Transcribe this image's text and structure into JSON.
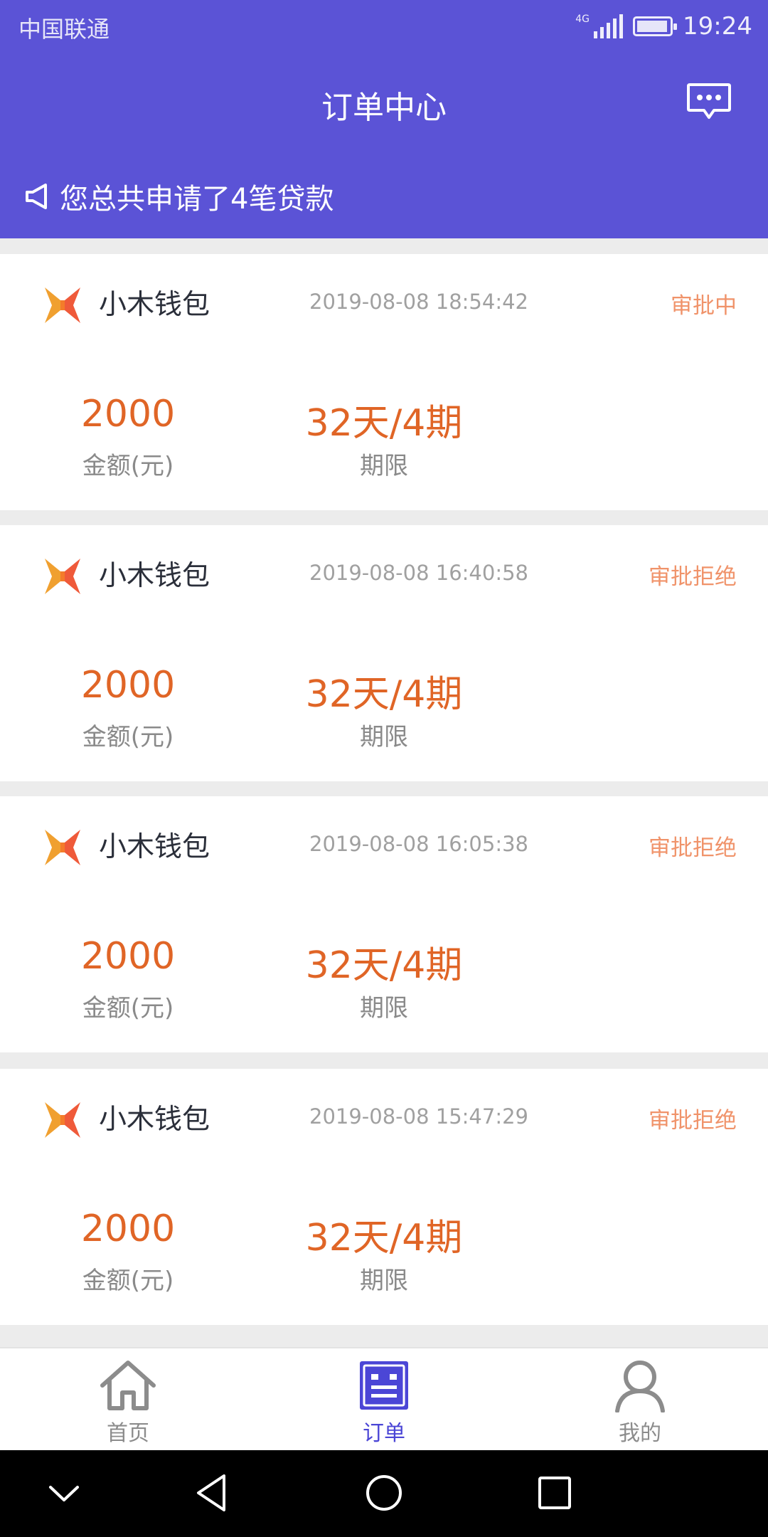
{
  "status_bar": {
    "carrier": "中国联通",
    "network": "4G",
    "time": "19:24"
  },
  "header": {
    "title": "订单中心",
    "message_icon": "chat-bubble-icon"
  },
  "notice": {
    "icon": "megaphone-icon",
    "text": "您总共申请了4笔贷款"
  },
  "orders": [
    {
      "app_name": "小木钱包",
      "date": "2019-08-08 18:54:42",
      "status": "审批中",
      "amount": "2000",
      "amount_label": "金额(元)",
      "term": "32天/4期",
      "term_label": "期限"
    },
    {
      "app_name": "小木钱包",
      "date": "2019-08-08 16:40:58",
      "status": "审批拒绝",
      "amount": "2000",
      "amount_label": "金额(元)",
      "term": "32天/4期",
      "term_label": "期限"
    },
    {
      "app_name": "小木钱包",
      "date": "2019-08-08 16:05:38",
      "status": "审批拒绝",
      "amount": "2000",
      "amount_label": "金额(元)",
      "term": "32天/4期",
      "term_label": "期限"
    },
    {
      "app_name": "小木钱包",
      "date": "2019-08-08 15:47:29",
      "status": "审批拒绝",
      "amount": "2000",
      "amount_label": "金额(元)",
      "term": "32天/4期",
      "term_label": "期限"
    }
  ],
  "tabs": [
    {
      "label": "首页",
      "icon": "home-icon",
      "active": false
    },
    {
      "label": "订单",
      "icon": "order-list-icon",
      "active": true
    },
    {
      "label": "我的",
      "icon": "user-icon",
      "active": false
    }
  ],
  "colors": {
    "header_bg": "#5b53d6",
    "amount": "#e06526",
    "status": "#f0936a",
    "tab_active": "#4b46d6"
  }
}
